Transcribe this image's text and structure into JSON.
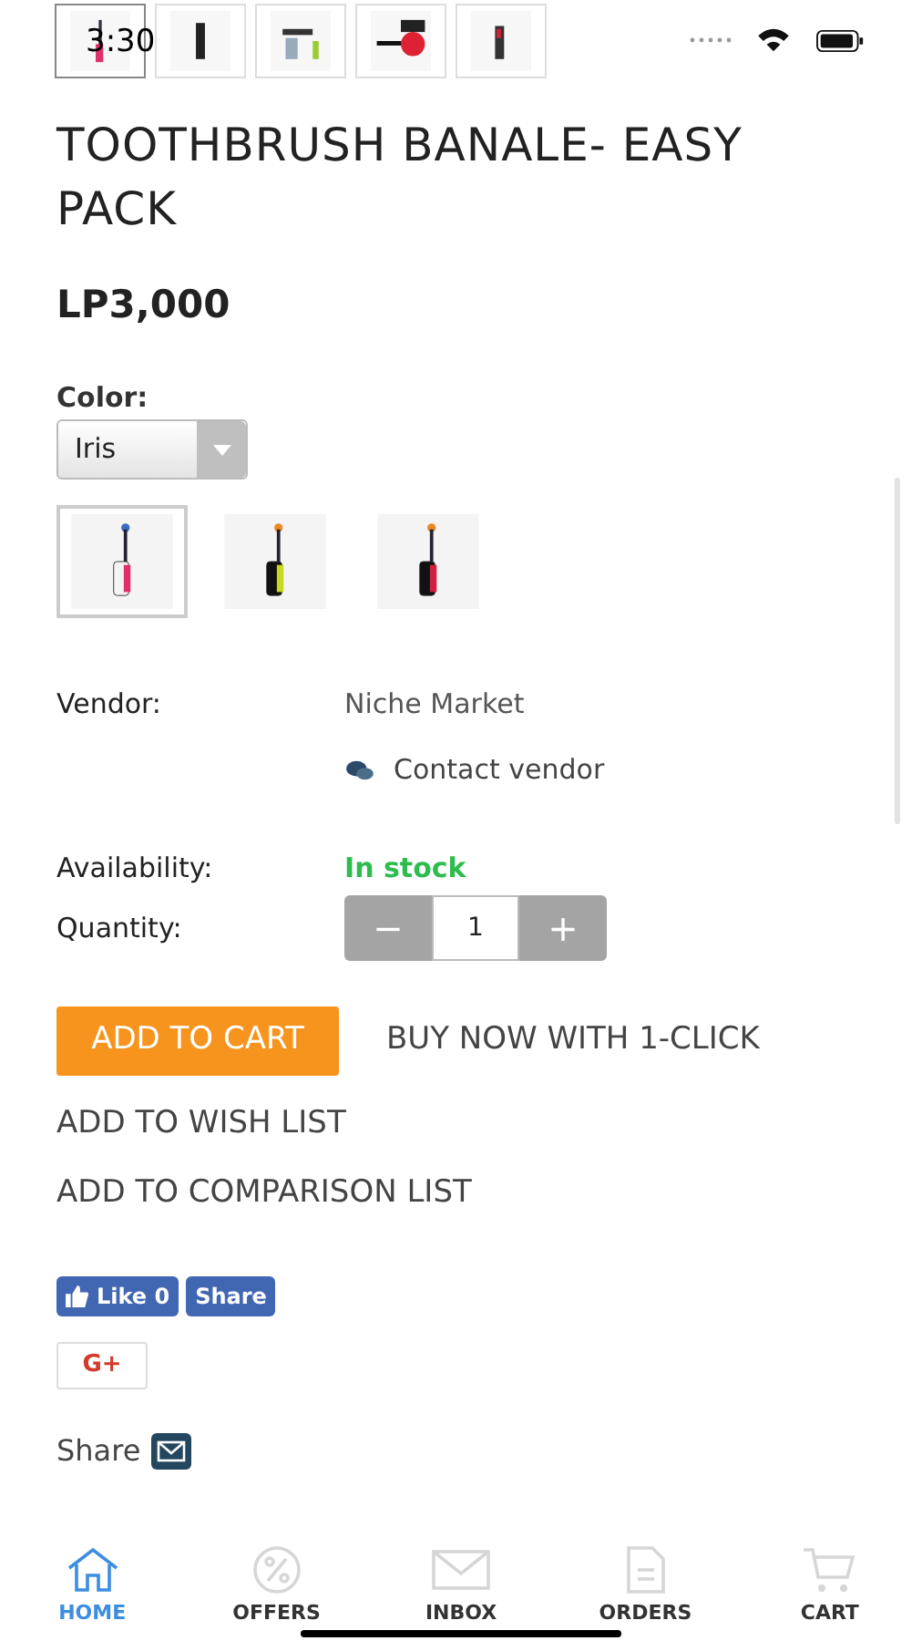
{
  "status_bar": {
    "time": "3:30"
  },
  "gallery": [
    {
      "kind": "picture",
      "selected": true
    },
    {
      "kind": "picture",
      "selected": false
    },
    {
      "kind": "picture",
      "selected": false
    },
    {
      "kind": "picture",
      "selected": false
    },
    {
      "kind": "picture",
      "selected": false
    }
  ],
  "product": {
    "title": "TOOTHBRUSH BANALE- EASY PACK",
    "price": "LP3,000"
  },
  "color": {
    "label": "Color:",
    "value": "Iris"
  },
  "variants": [
    {
      "kind": "picture",
      "selected": true
    },
    {
      "kind": "picture",
      "selected": false
    },
    {
      "kind": "picture",
      "selected": false
    }
  ],
  "details": {
    "vendor_label": "Vendor:",
    "vendor": "Niche Market",
    "contact": "Contact vendor",
    "availability_label": "Availability:",
    "availability": "In stock",
    "quantity_label": "Quantity:",
    "quantity": "1",
    "minus": "−",
    "plus": "+"
  },
  "actions": {
    "add_to_cart": "ADD TO CART",
    "buy_now": "BUY NOW WITH 1-CLICK",
    "wish_list": "ADD TO WISH LIST",
    "comparison": "ADD TO COMPARISON LIST"
  },
  "social": {
    "like": "Like 0",
    "share": "Share",
    "gplus": "G+",
    "email_share": "Share"
  },
  "tab_bar": [
    {
      "kind": "home",
      "label": "HOME",
      "selected": true
    },
    {
      "kind": "offers",
      "label": "OFFERS",
      "selected": false
    },
    {
      "kind": "inbox",
      "label": "INBOX",
      "selected": false
    },
    {
      "kind": "orders",
      "label": "ORDERS",
      "selected": false
    },
    {
      "kind": "cart",
      "label": "CART",
      "selected": false
    }
  ]
}
